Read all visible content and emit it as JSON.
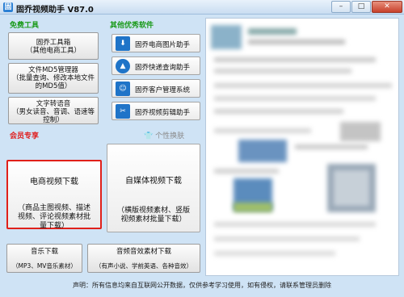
{
  "window": {
    "title": "固乔视频助手 V87.0",
    "icon_name": "app-logo-icon",
    "controls": [
      "–",
      "□",
      "✕"
    ]
  },
  "free_tools": {
    "title": "免费工具",
    "buttons": [
      {
        "label": "固乔工具箱\n（其他电商工具）"
      },
      {
        "label": "文件MD5管理器\n（批量查询、修改本地文件\n的MD5值）"
      },
      {
        "label": "文字转语音\n（男女读音、音调、语速等\n控制）"
      }
    ]
  },
  "other_software": {
    "title": "其他优秀软件",
    "items": [
      {
        "label": "固乔电商图片助手",
        "icon_name": "image-download-icon"
      },
      {
        "label": "固乔快递查询助手",
        "icon_name": "express-icon"
      },
      {
        "label": "固乔客户管理系统",
        "icon_name": "customer-icon"
      },
      {
        "label": "固乔视频剪辑助手",
        "icon_name": "scissors-icon"
      }
    ]
  },
  "member": {
    "title": "会员专享",
    "skin_label": "个性换肤",
    "ecommerce": {
      "title": "电商视频下载",
      "desc": "（商品主图视频、描述\n视频、评论视频素材批\n量下载）"
    },
    "media": {
      "title": "自媒体视频下载",
      "desc": "（横版视频素材、竖版\n视频素材批量下载）"
    },
    "music": {
      "title": "音乐下载",
      "desc": "（MP3、MV音乐素材）"
    },
    "sfx": {
      "title": "音频音效素材下载",
      "desc": "（有声小说、学前英语、各种音效）"
    }
  },
  "footer": {
    "text": "声明：所有信息均来自互联网公开数据，仅供参考学习使用，如有侵权，请联系管理员删除"
  },
  "colors": {
    "free_title": "#1a9a1a",
    "member_title": "#e02020",
    "highlight_border": "#e0201a"
  }
}
